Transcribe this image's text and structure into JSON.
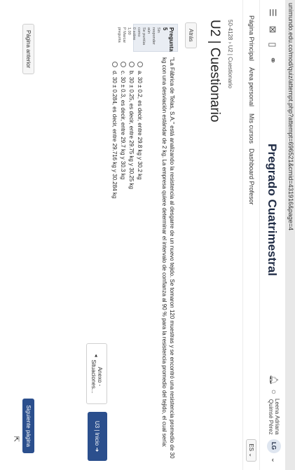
{
  "browser": {
    "url": "unimundo.edu.co/mod/quiz/attempt.php?attempt=696521&cmid=431916&page=4"
  },
  "header": {
    "site_title": "Pregrado Cuatrimestral",
    "user_name_line1": "Leena Adriana",
    "user_name_line2": "Quimsé Pérez",
    "avatar_initials": "LG"
  },
  "nav": {
    "items": [
      "Página Principal",
      "Área personal",
      "Mis cursos",
      "Dashboard Profesor"
    ],
    "language": "ES ⌄"
  },
  "breadcrumb": "50-4128 › U2 | Cuestionario",
  "page_title": "U2 | Cuestionario",
  "back_button": "Atrás",
  "question": {
    "number_label": "Pregunta 5",
    "meta": [
      "Sin responder",
      "aún",
      "Se puntúa como",
      "0 sobre 1,00",
      "P Marcar",
      "pregunta"
    ],
    "text": "\"La Fábrica de Telas, S.A.\" está analizando la resistencia al desgarre de un nuevo tejido. Se tomaron 120 muestras y se encontró una resistencia promedio de 30 kg con una desviación estándar de 2 kg. La empresa quiere determinar el intervalo de confianza al 90 % para la resistencia promedio del tejido, el cual sería:",
    "options": [
      "a.   30 ± 0.2, es decir, entre 29.8 kg y 30.2 kg",
      "b.   30 ± 0.25, es decir, entre 29.75 kg y 30.25 kg",
      "c.   30 ± 0.3, es decir, entre 29.7 kg y 30.3 kg",
      "d.   30 ± 0.284, es decir, entre 29.716 kg y 30.284 kg"
    ]
  },
  "footer": {
    "prev_button": "Página anterior",
    "next_button": "Siguiente página"
  },
  "activity_nav": {
    "prev_label_line1": "Anexo -",
    "prev_label_line2": "Situaciones...",
    "next_label": "U3 | Inicio ➜"
  }
}
